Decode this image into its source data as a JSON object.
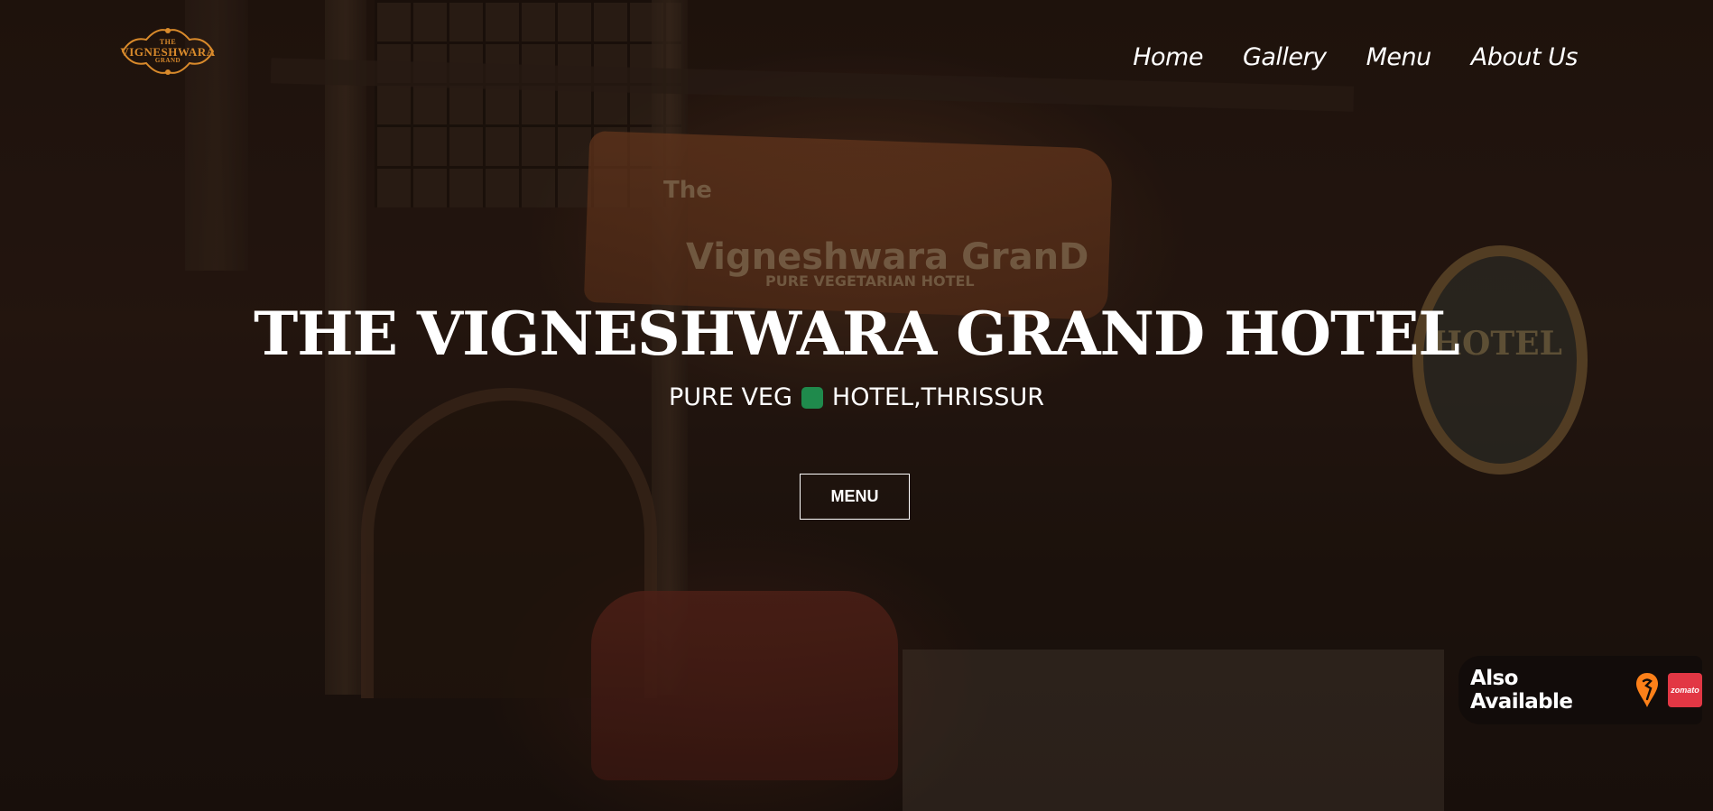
{
  "brand": {
    "logo_text": "VIGNESHWARA",
    "logo_top": "THE",
    "logo_bottom": "GRAND",
    "logo_color": "#d98a2b"
  },
  "nav": {
    "items": [
      {
        "label": "Home"
      },
      {
        "label": "Gallery"
      },
      {
        "label": "Menu"
      },
      {
        "label": "About Us"
      }
    ]
  },
  "hero": {
    "title": "THE VIGNESHWARA GRAND HOTEL",
    "subtitle_left": "PURE VEG",
    "subtitle_right": "HOTEL,THRISSUR",
    "veg_indicator_color": "#1f8a4c",
    "menu_button_label": "MENU"
  },
  "delivery": {
    "label": "Also Available",
    "swiggy_icon": "swiggy-icon",
    "swiggy_color": "#fc8019",
    "zomato_label": "zomato",
    "zomato_color": "#e23744"
  },
  "background_signage": {
    "banner_the": "The",
    "banner_name": "Vigneshwara GranD",
    "banner_tag": "PURE VEGETARIAN HOTEL",
    "round_sign": "HOTEL"
  }
}
